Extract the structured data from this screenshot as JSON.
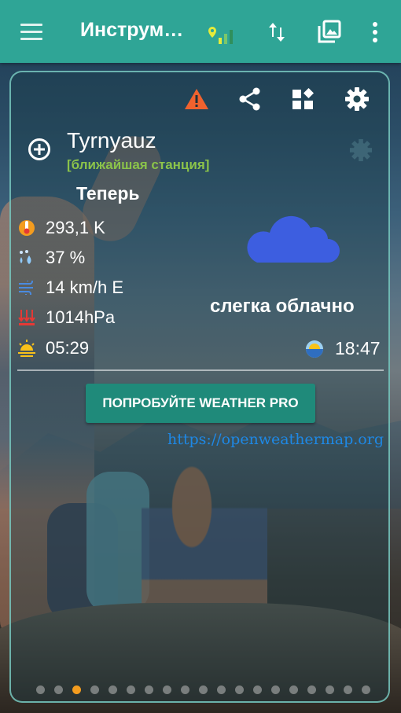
{
  "app_bar": {
    "title": "Инструм…",
    "icons": [
      "menu-icon",
      "signal-icon",
      "sort-icon",
      "gallery-icon",
      "more-vert-icon"
    ]
  },
  "card": {
    "toolbar_icons": [
      "warning-icon",
      "share-icon",
      "widgets-icon",
      "settings-icon"
    ],
    "location": {
      "city": "Tyrnyauz",
      "station_label": "[ближайшая станция]"
    },
    "now_label": "Теперь",
    "rows": [
      {
        "icon": "thermometer-icon",
        "value": "293,1 K"
      },
      {
        "icon": "humidity-icon",
        "value": "37 %"
      },
      {
        "icon": "wind-icon",
        "value": "14 km/h E"
      },
      {
        "icon": "pressure-icon",
        "value": "1014hPa"
      },
      {
        "icon": "sunrise-icon",
        "value": "05:29"
      }
    ],
    "condition": "слегка облачно",
    "sunset": {
      "icon": "sunset-icon",
      "value": "18:47"
    },
    "pro_button": "ПОПРОБУЙТЕ WEATHER PRO",
    "link": "https://openweathermap.org"
  },
  "pager": {
    "count": 19,
    "active_index": 2
  },
  "colors": {
    "accent": "#2fa596",
    "station": "#8bc34a",
    "warning": "#f0622e",
    "cloud": "#3d5ee0",
    "link": "#1e88e5",
    "active_dot": "#f39c1f"
  }
}
